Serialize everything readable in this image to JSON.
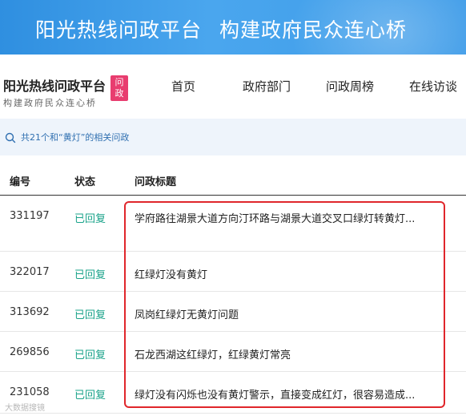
{
  "banner": {
    "title": "阳光热线问政平台",
    "slogan": "构建政府民众连心桥"
  },
  "brand": {
    "title": "阳光热线问政平台",
    "subtitle": "构建政府民众连心桥",
    "badge_line1": "问",
    "badge_line2": "政"
  },
  "nav": {
    "items": [
      {
        "label": "首页"
      },
      {
        "label": "政府部门"
      },
      {
        "label": "问政周榜"
      },
      {
        "label": "在线访谈"
      }
    ]
  },
  "search": {
    "result_text": "共21个和“黄灯”的相关问政"
  },
  "table": {
    "headers": {
      "id": "编号",
      "status": "状态",
      "title": "问政标题"
    },
    "rows": [
      {
        "id": "331197",
        "status": "已回复",
        "title": "学府路往湖景大道方向汀环路与湖景大道交叉口绿灯转黄灯..."
      },
      {
        "id": "322017",
        "status": "已回复",
        "title": "红绿灯没有黄灯"
      },
      {
        "id": "313692",
        "status": "已回复",
        "title": "凤岗红绿灯无黄灯问题"
      },
      {
        "id": "269856",
        "status": "已回复",
        "title": "石龙西湖这红绿灯，红绿黄灯常亮"
      },
      {
        "id": "231058",
        "status": "已回复",
        "title": "绿灯没有闪烁也没有黄灯警示，直接变成红灯，很容易造成..."
      }
    ]
  },
  "watermark": "大数据搜镜",
  "colors": {
    "banner_blue": "#3d9be8",
    "status_green": "#1aa38a",
    "badge_pink": "#e83d6f",
    "highlight_red": "#e0262b"
  }
}
